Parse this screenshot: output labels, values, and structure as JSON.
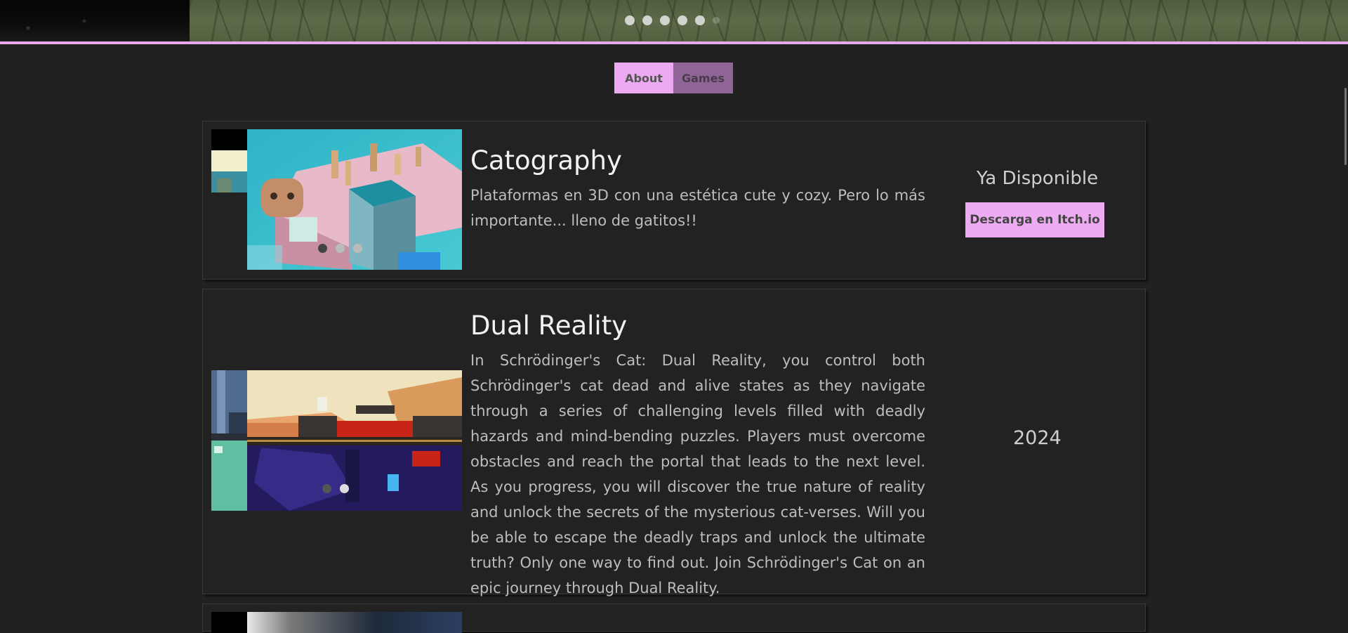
{
  "tabs": {
    "about": "About",
    "games": "Games"
  },
  "colors": {
    "accent": "#edaaf2",
    "background": "#212121",
    "tab_inactive": "#8e6596"
  },
  "hero": {
    "slide_count": 6
  },
  "games": [
    {
      "title": "Catography",
      "description": "Plataformas en 3D con una estética cute y cozy. Pero lo más importante... lleno de gatitos!!",
      "status": "Ya Disponible",
      "download_label": "Descarga en Itch.io",
      "carousel_dots": 3
    },
    {
      "title": "Dual Reality",
      "description": "In Schrödinger's Cat: Dual Reality, you control both Schrödinger's cat dead and alive states as they navigate through a series of challenging levels filled with deadly hazards and mind-bending puzzles. Players must overcome obstacles and reach the portal that leads to the next level. As you progress, you will discover the true nature of reality and unlock the secrets of the mysterious cat-verses. Will you be able to escape the deadly traps and unlock the ultimate truth? Only one way to find out. Join Schrödinger's Cat on an epic journey through Dual Reality.",
      "year": "2024",
      "carousel_dots": 2
    }
  ]
}
